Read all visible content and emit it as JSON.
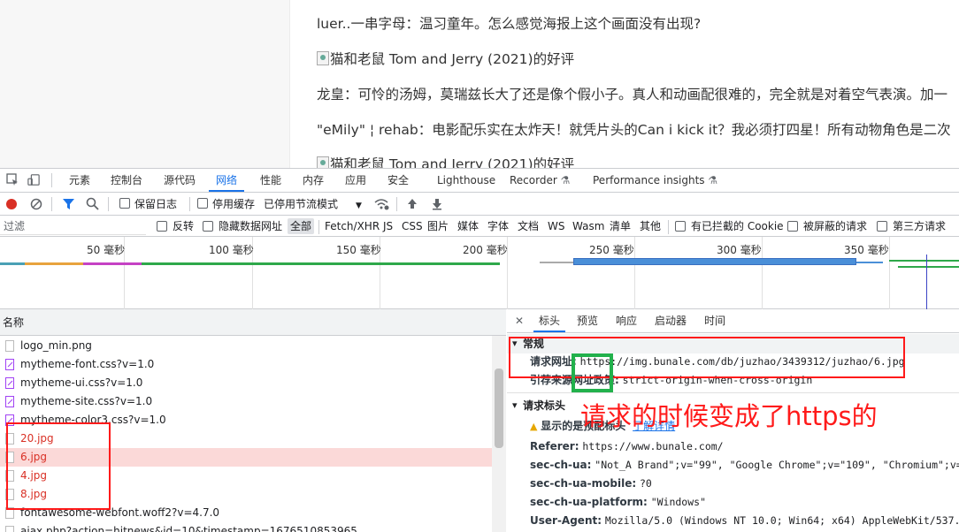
{
  "page": {
    "lines": [
      "luer..一串字母：温习童年。怎么感觉海报上这个画面没有出现?",
      "猫和老鼠 Tom and Jerry (2021)的好评",
      "龙皇：可怜的汤姆，莫瑞兹长大了还是像个假小子。真人和动画配很难的，完全就是对着空气表演。加一",
      "\"eMily\" ¦ rehab：电影配乐实在太炸天！就凭片头的Can i kick it？我必须打四星！所有动物角色是二次",
      "猫和老鼠 Tom and Jerry (2021)的好评"
    ]
  },
  "devtools": {
    "tabs": [
      "元素",
      "控制台",
      "源代码",
      "网络",
      "性能",
      "内存",
      "应用",
      "安全",
      "Lighthouse",
      "Recorder",
      "Performance insights"
    ],
    "active_tab": "网络",
    "toolbar": {
      "preserve_log": "保留日志",
      "disable_cache": "停用缓存",
      "throttle": "已停用节流模式"
    },
    "filter": {
      "placeholder": "过滤",
      "invert": "反转",
      "hide_data_urls": "隐藏数据网址",
      "types": [
        "全部",
        "Fetch/XHR",
        "JS",
        "CSS",
        "图片",
        "媒体",
        "字体",
        "文档",
        "WS",
        "Wasm",
        "清单",
        "其他"
      ],
      "active_type": "全部",
      "blocked_cookies": "有已拦截的 Cookie",
      "blocked_requests": "被屏蔽的请求",
      "third_party": "第三方请求"
    },
    "timeline": {
      "ticks": [
        "50 毫秒",
        "100 毫秒",
        "150 毫秒",
        "200 毫秒",
        "250 毫秒",
        "300 毫秒",
        "350 毫秒"
      ]
    },
    "list": {
      "header": "名称",
      "rows": [
        {
          "name": "logo_min.png",
          "type": "img",
          "error": false
        },
        {
          "name": "mytheme-font.css?v=1.0",
          "type": "css",
          "error": false
        },
        {
          "name": "mytheme-ui.css?v=1.0",
          "type": "css",
          "error": false
        },
        {
          "name": "mytheme-site.css?v=1.0",
          "type": "css",
          "error": false
        },
        {
          "name": "mytheme-color3.css?v=1.0",
          "type": "css",
          "error": false
        },
        {
          "name": "20.jpg",
          "type": "img",
          "error": true
        },
        {
          "name": "6.jpg",
          "type": "img",
          "error": true,
          "selected": true
        },
        {
          "name": "4.jpg",
          "type": "img",
          "error": true
        },
        {
          "name": "8.jpg",
          "type": "img",
          "error": true
        },
        {
          "name": "fontawesome-webfont.woff2?v=4.7.0",
          "type": "font",
          "error": false
        },
        {
          "name": "ajax.php?action=hitnews&id=10&timestamp=1676510853965",
          "type": "xhr",
          "error": false
        }
      ]
    },
    "details": {
      "tabs": [
        "标头",
        "预览",
        "响应",
        "启动器",
        "时间"
      ],
      "active_tab": "标头",
      "general_title": "常规",
      "request_url_key": "请求网址:",
      "request_url_value": "https://img.bunale.com/db/juzhao/3439312/juzhao/6.jpg",
      "referrer_policy_key": "引荐来源网址政策:",
      "referrer_policy_value": "strict-origin-when-cross-origin",
      "request_headers_title": "请求标头",
      "provisional_warning": "显示的是预配标头",
      "learn_more": "了解详情",
      "headers": [
        {
          "key": "Referer:",
          "value": "https://www.bunale.com/"
        },
        {
          "key": "sec-ch-ua:",
          "value": "\"Not_A Brand\";v=\"99\", \"Google Chrome\";v=\"109\", \"Chromium\";v=\"109\""
        },
        {
          "key": "sec-ch-ua-mobile:",
          "value": "?0"
        },
        {
          "key": "sec-ch-ua-platform:",
          "value": "\"Windows\""
        },
        {
          "key": "User-Agent:",
          "value": "Mozilla/5.0 (Windows NT 10.0; Win64; x64) AppleWebKit/537.36 (K"
        }
      ]
    }
  },
  "annotation": {
    "text": "请求的时候变成了https的",
    "color": "#ff1a1a"
  }
}
